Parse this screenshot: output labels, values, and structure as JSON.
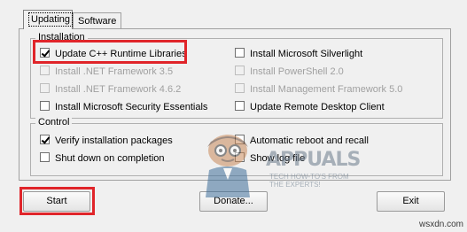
{
  "tabs": [
    {
      "label": "Updating",
      "active": true
    },
    {
      "label": "Software",
      "active": false
    }
  ],
  "installation": {
    "legend": "Installation",
    "left_options": [
      {
        "label": "Update C++ Runtime Libraries",
        "checked": true,
        "enabled": true
      },
      {
        "label": "Install .NET Framework 3.5",
        "checked": false,
        "enabled": false
      },
      {
        "label": "Install .NET Framework 4.6.2",
        "checked": false,
        "enabled": false
      },
      {
        "label": "Install Microsoft Security Essentials",
        "checked": false,
        "enabled": true
      }
    ],
    "right_options": [
      {
        "label": "Install Microsoft Silverlight",
        "checked": false,
        "enabled": true
      },
      {
        "label": "Install PowerShell 2.0",
        "checked": false,
        "enabled": false
      },
      {
        "label": "Install Management Framework 5.0",
        "checked": false,
        "enabled": false
      },
      {
        "label": "Update Remote Desktop Client",
        "checked": false,
        "enabled": true
      }
    ]
  },
  "control": {
    "legend": "Control",
    "left_options": [
      {
        "label": "Verify installation packages",
        "checked": true,
        "enabled": true
      },
      {
        "label": "Shut down on completion",
        "checked": false,
        "enabled": true
      }
    ],
    "right_options": [
      {
        "label": "Automatic reboot and recall",
        "checked": false,
        "enabled": true
      },
      {
        "label": "Show log file",
        "checked": false,
        "enabled": true
      }
    ]
  },
  "buttons": {
    "start": "Start",
    "donate": "Donate...",
    "exit": "Exit"
  },
  "watermark": {
    "brand": "APPUALS",
    "tagline_line1": "TECH HOW-TO'S FROM",
    "tagline_line2": "THE EXPERTS!"
  },
  "site_label": "wsxdn.com",
  "colors": {
    "highlight": "#e0252a",
    "window_bg": "#f0f0f0"
  }
}
